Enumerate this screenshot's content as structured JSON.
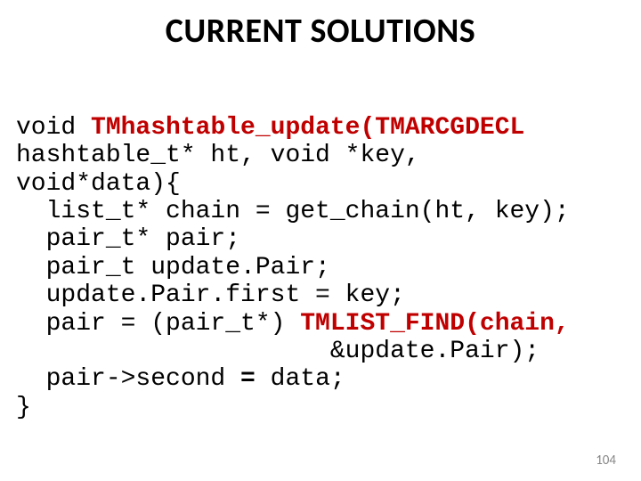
{
  "title": "CURRENT SOLUTIONS",
  "code": {
    "l1a": "void",
    "l1b": " TMhashtable_update(TMARCGDECL",
    "l2": "hashtable_t* ht, void *key,",
    "l3": "void*data){",
    "l4": "  list_t* chain = get_chain(ht, key);",
    "l5": "  pair_t* pair;",
    "l6": "  pair_t update.Pair;",
    "l7": "  update.Pair.first = key;",
    "l8a": "  pair = (pair_t*)",
    "l8b": " TMLIST_FIND(chain,",
    "l9": "                     &update.Pair);",
    "l10a": "  pair->second",
    "l10b": " = ",
    "l10c": "data;",
    "l11": "}"
  },
  "pagenum": "104"
}
